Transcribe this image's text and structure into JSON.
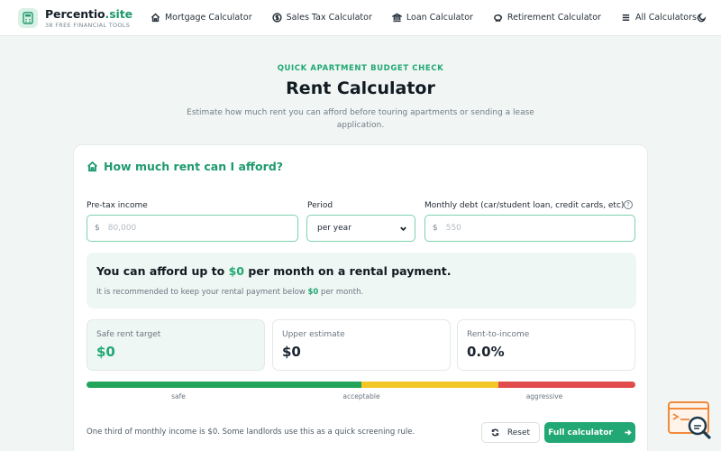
{
  "header": {
    "brand_name": "Percentio",
    "brand_tld": ".site",
    "brand_tagline": "38 FREE FINANCIAL TOOLS",
    "nav": [
      {
        "label": "Mortgage Calculator",
        "icon": "home-icon"
      },
      {
        "label": "Sales Tax Calculator",
        "icon": "dollar-circle-icon"
      },
      {
        "label": "Loan Calculator",
        "icon": "bank-icon"
      },
      {
        "label": "Retirement Calculator",
        "icon": "piggy-bank-icon"
      },
      {
        "label": "All Calculators",
        "icon": "list-icon"
      }
    ],
    "theme_icon": "moon-icon"
  },
  "hero": {
    "eyebrow": "QUICK APARTMENT BUDGET CHECK",
    "title": "Rent Calculator",
    "subtitle": "Estimate how much rent you can afford before touring apartments or sending a lease application."
  },
  "card": {
    "heading": "How much rent can I afford?",
    "income": {
      "label": "Pre-tax income",
      "prefix": "$",
      "placeholder": "80,000"
    },
    "period": {
      "label": "Period",
      "selected": "per year"
    },
    "debt": {
      "label": "Monthly debt (car/student loan, credit cards, etc)",
      "prefix": "$",
      "placeholder": "550"
    },
    "result": {
      "headline_pre": "You can afford up to ",
      "headline_amount": "$0",
      "headline_post": " per month on a rental payment.",
      "note_pre": "It is recommended to keep your rental payment below ",
      "note_amount": "$0",
      "note_post": " per month."
    },
    "stats": [
      {
        "label": "Safe rent target",
        "value": "$0"
      },
      {
        "label": "Upper estimate",
        "value": "$0"
      },
      {
        "label": "Rent-to-income",
        "value": "0.0%"
      }
    ],
    "scale_labels": {
      "safe": "safe",
      "acceptable": "acceptable",
      "aggressive": "aggressive"
    },
    "scale_fractions": {
      "safe": 0.5,
      "acceptable": 0.25,
      "aggressive": 0.25
    },
    "footnote": "One third of monthly income is $0. Some landlords use this as a quick screening rule.",
    "reset_label": "Reset",
    "full_label": "Full calculator"
  },
  "colors": {
    "accent": "#21a874",
    "safe": "#22a45a",
    "acceptable": "#f2c624",
    "aggressive": "#e24b4b"
  }
}
